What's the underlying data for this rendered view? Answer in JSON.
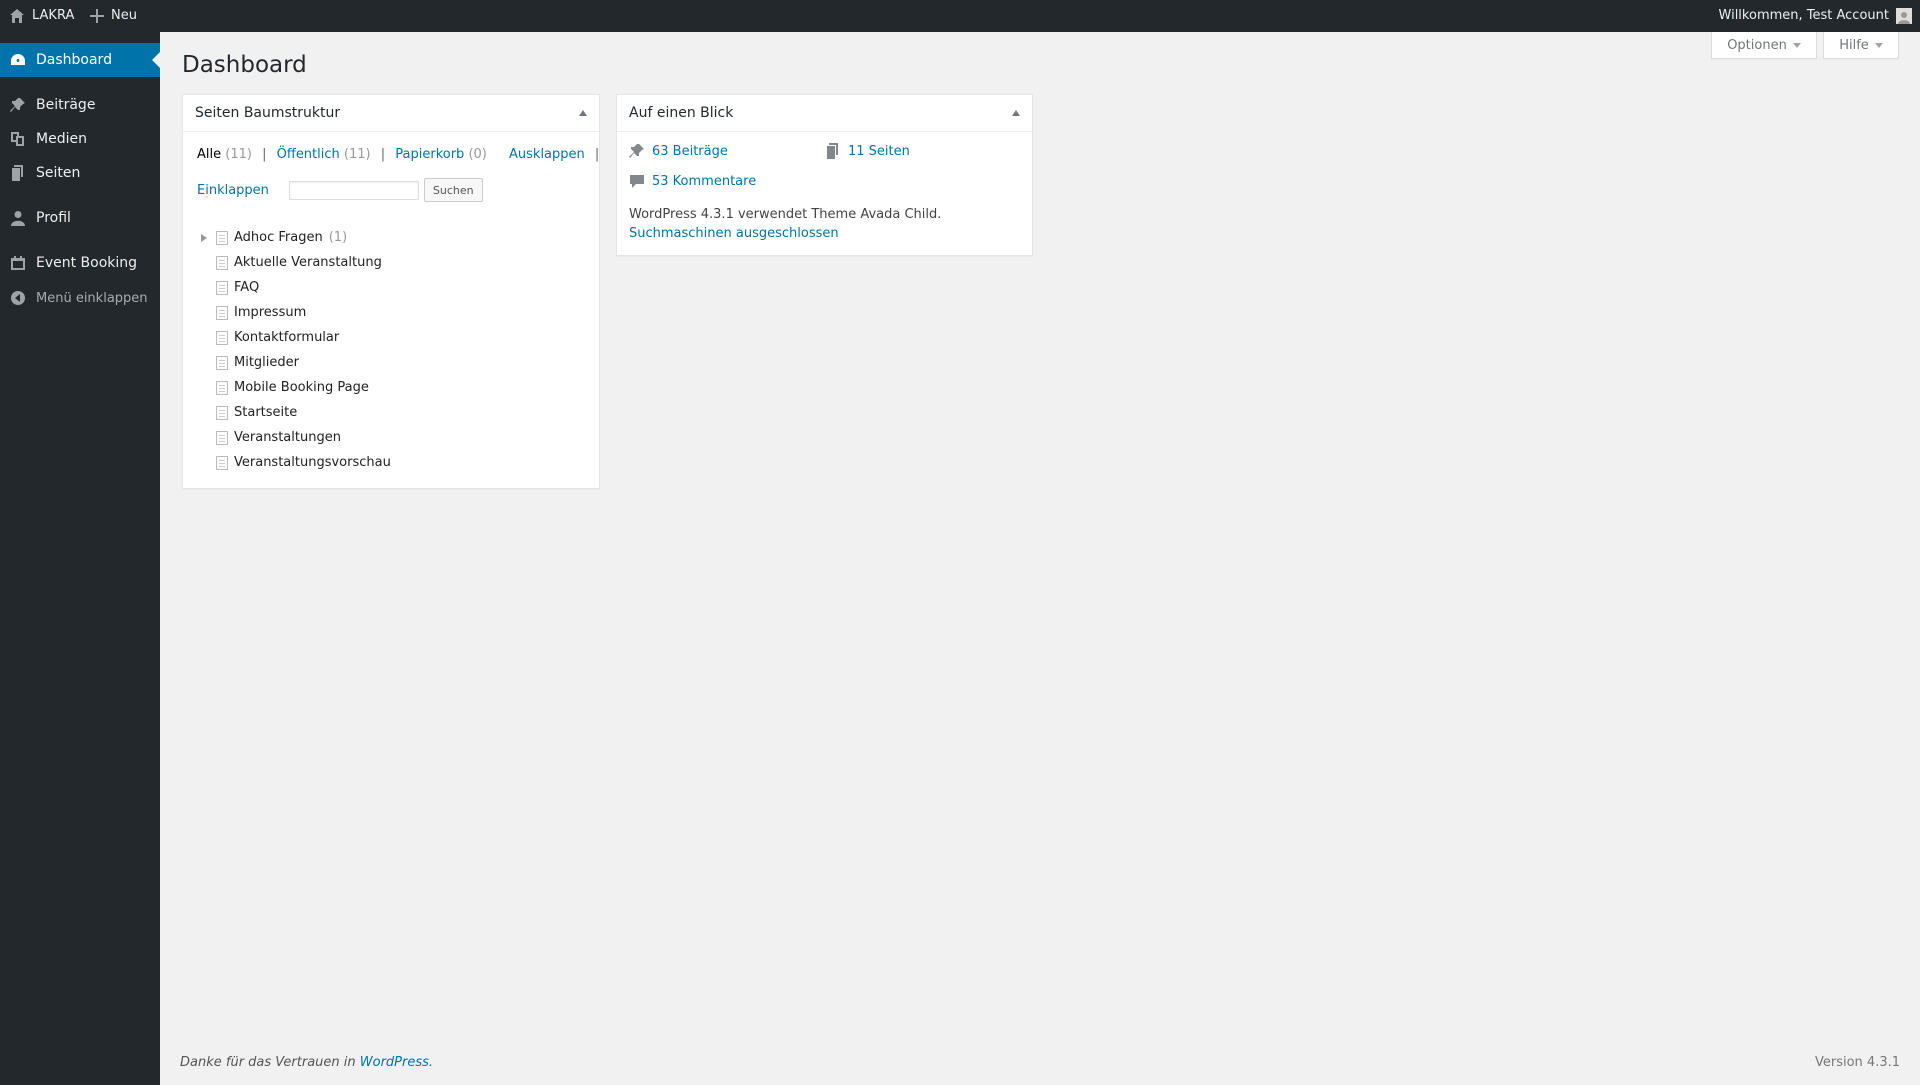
{
  "adminbar": {
    "site_name": "LAKRA",
    "new_label": "Neu",
    "account_label": "Willkommen, Test Account"
  },
  "sidebar": {
    "items": [
      {
        "label": "Dashboard",
        "icon": "dashboard-icon",
        "current": true
      },
      {
        "label": "Beiträge",
        "icon": "pin-icon"
      },
      {
        "label": "Medien",
        "icon": "media-icon"
      },
      {
        "label": "Seiten",
        "icon": "pages-icon"
      },
      {
        "label": "Profil",
        "icon": "user-icon"
      },
      {
        "label": "Event Booking",
        "icon": "calendar-icon"
      }
    ],
    "collapse_label": "Menü einklappen"
  },
  "header": {
    "title": "Dashboard",
    "options_label": "Optionen",
    "help_label": "Hilfe"
  },
  "tree_box": {
    "title": "Seiten Baumstruktur",
    "filters": [
      {
        "label": "Alle",
        "count": "(11)"
      },
      {
        "label": "Öffentlich",
        "count": "(11)"
      },
      {
        "label": "Papierkorb",
        "count": "(0)"
      }
    ],
    "expand_label": "Ausklappen",
    "collapse_label": "Einklappen",
    "search_button": "Suchen",
    "search_value": "",
    "pages": [
      {
        "title": "Adhoc Fragen",
        "children": "(1)"
      },
      {
        "title": "Aktuelle Veranstaltung"
      },
      {
        "title": "FAQ"
      },
      {
        "title": "Impressum"
      },
      {
        "title": "Kontaktformular"
      },
      {
        "title": "Mitglieder"
      },
      {
        "title": "Mobile Booking Page"
      },
      {
        "title": "Startseite"
      },
      {
        "title": "Veranstaltungen"
      },
      {
        "title": "Veranstaltungsvorschau"
      }
    ]
  },
  "glance_box": {
    "title": "Auf einen Blick",
    "posts": "63 Beiträge",
    "pages": "11 Seiten",
    "comments": "53 Kommentare",
    "theme_text": "WordPress 4.3.1 verwendet Theme Avada Child.",
    "search_engines": "Suchmaschinen ausgeschlossen"
  },
  "footer": {
    "thanks_prefix": "Danke für das Vertrauen in",
    "wordpress_link": "WordPress",
    "thanks_suffix": ".",
    "version": "Version 4.3.1"
  },
  "colors": {
    "adminbar_bg": "#23282d",
    "accent": "#0073aa",
    "background": "#f1f1f1"
  }
}
